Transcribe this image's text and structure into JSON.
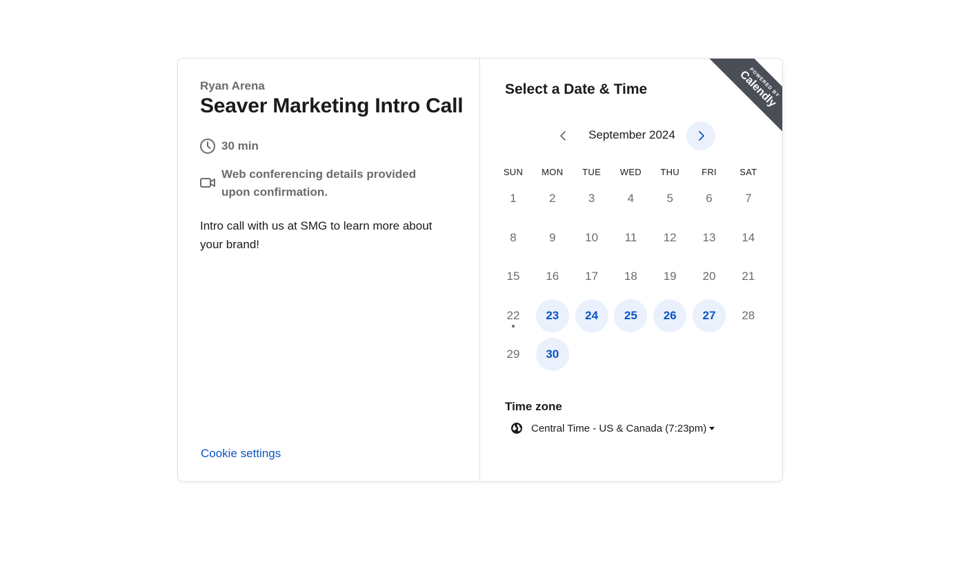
{
  "event": {
    "organizer": "Ryan Arena",
    "title": "Seaver Marketing Intro Call",
    "duration": "30 min",
    "conferencing": "Web conferencing details provided upon confirmation.",
    "description": "Intro call with us at SMG to learn more about your brand!",
    "cookie_settings": "Cookie settings"
  },
  "scheduler": {
    "title": "Select a Date & Time",
    "badge_small": "POWERED BY",
    "badge_brand": "Calendly",
    "month": "September 2024",
    "weekdays": [
      "SUN",
      "MON",
      "TUE",
      "WED",
      "THU",
      "FRI",
      "SAT"
    ],
    "weeks": [
      [
        "1",
        "2",
        "3",
        "4",
        "5",
        "6",
        "7"
      ],
      [
        "8",
        "9",
        "10",
        "11",
        "12",
        "13",
        "14"
      ],
      [
        "15",
        "16",
        "17",
        "18",
        "19",
        "20",
        "21"
      ],
      [
        "22",
        "23",
        "24",
        "25",
        "26",
        "27",
        "28"
      ],
      [
        "29",
        "30",
        "",
        "",
        "",
        "",
        ""
      ]
    ],
    "available_days": [
      "23",
      "24",
      "25",
      "26",
      "27",
      "30"
    ],
    "today": "22",
    "accent_color": "#0b54c4",
    "available_bg_color": "#eaf1fc",
    "timezone_label": "Time zone",
    "timezone_value": "Central Time - US & Canada (7:23pm)"
  }
}
